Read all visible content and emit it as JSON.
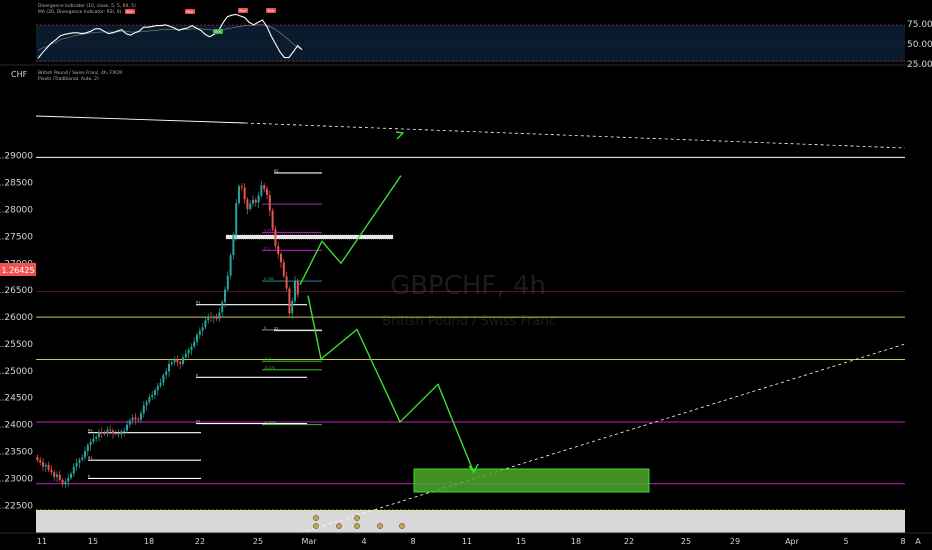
{
  "symbol": "GBPCHF",
  "timeframe": "4h",
  "watermark_title": "GBPCHF, 4h",
  "watermark_subtitle": "British Pound / Swiss Franc",
  "currency_button": "CHF",
  "legend_main": "British Pound / Swiss Franc, 4h, FXCM",
  "legend_pivots": "Pivots (Traditional, Auto, 2)",
  "osc_legend_1": "Divergence Indicator (10, close, 5, 5, 60, 5)",
  "osc_legend_2": "MA (20, Divergence Indicator: RSI, 0)",
  "current_price_label": "1.26425",
  "axis_corner_label": "A",
  "colors": {
    "up": "#26a69a",
    "down": "#ef5350",
    "projection": "#39e02f",
    "target_zone": "#4ea82a",
    "pivot_yellow": "#d4c64a",
    "pivot_magenta": "#c21fc2",
    "trend_white": "#ffffff"
  },
  "chart_data": [
    {
      "type": "line",
      "title": "GBPCHF, 4h",
      "subtitle": "British Pound / Swiss Franc",
      "ylim": [
        1.2232,
        1.2985
      ],
      "y_ticks": [
        "1.29000",
        "1.28500",
        "1.28000",
        "1.27500",
        "1.27000",
        "1.26500",
        "1.26000",
        "1.25500",
        "1.25000",
        "1.24500",
        "1.24000",
        "1.23500",
        "1.23000",
        "1.22500"
      ],
      "x_ticks": [
        "11",
        "15",
        "18",
        "22",
        "25",
        "Mar",
        "4",
        "8",
        "11",
        "15",
        "18",
        "22",
        "25",
        "29",
        "Apr",
        "5",
        "8"
      ],
      "current_price": 1.26425,
      "candle_closes": [
        1.2334,
        1.233,
        1.2322,
        1.2325,
        1.2316,
        1.2312,
        1.2303,
        1.2307,
        1.2297,
        1.229,
        1.2294,
        1.2301,
        1.2309,
        1.2322,
        1.2329,
        1.2335,
        1.2339,
        1.2351,
        1.2362,
        1.2368,
        1.2374,
        1.2377,
        1.2386,
        1.2385,
        1.2383,
        1.2391,
        1.2389,
        1.2384,
        1.2384,
        1.2382,
        1.2388,
        1.2389,
        1.24,
        1.2408,
        1.2413,
        1.241,
        1.2409,
        1.2421,
        1.2436,
        1.2442,
        1.2451,
        1.2455,
        1.2464,
        1.2472,
        1.2478,
        1.2492,
        1.2499,
        1.2513,
        1.2516,
        1.2521,
        1.2516,
        1.2513,
        1.2525,
        1.2532,
        1.2539,
        1.2545,
        1.2554,
        1.2567,
        1.2575,
        1.2581,
        1.2594,
        1.2601,
        1.2599,
        1.26,
        1.2597,
        1.2609,
        1.2628,
        1.2651,
        1.2677,
        1.2715,
        1.2752,
        1.2812,
        1.2843,
        1.2841,
        1.2819,
        1.2801,
        1.2811,
        1.2818,
        1.2813,
        1.2826,
        1.2845,
        1.2838,
        1.2827,
        1.2798,
        1.2764,
        1.2732,
        1.2717,
        1.2702,
        1.2676,
        1.2653,
        1.2607,
        1.263,
        1.2668,
        1.2642
      ],
      "pivot_lines": [
        {
          "price": 1.2897,
          "color": "#ffffff",
          "style": "solid"
        },
        {
          "price": 1.2647,
          "color": "#ef5350",
          "style": "solid"
        },
        {
          "price": 1.26,
          "color": "#d4c64a",
          "style": "solid"
        },
        {
          "price": 1.2521,
          "color": "#d4c64a",
          "style": "solid"
        },
        {
          "price": 1.2405,
          "color": "#c21fc2",
          "style": "solid"
        },
        {
          "price": 1.229,
          "color": "#c21fc2",
          "style": "solid"
        }
      ],
      "resistance_band": {
        "from": 1.2694,
        "to": 1.2698
      },
      "target_zone": {
        "from": 1.2289,
        "to": 1.2318
      },
      "pivot_labels": [
        "R2",
        "R1",
        "P",
        "S1",
        "S2"
      ],
      "fib_labels": [
        "0.618",
        "0.5",
        "0.382",
        "0",
        "-0.2",
        "-0.272",
        "-0.618"
      ],
      "projection_path": [
        1.266,
        1.2741,
        1.27,
        1.2863
      ],
      "bearish_path": [
        1.264,
        1.2522,
        1.2577,
        1.2405,
        1.2475,
        1.231
      ]
    },
    {
      "type": "line",
      "title": "Divergence Indicator",
      "ylim": [
        20,
        100
      ],
      "y_ticks": [
        "75.00",
        "50.00",
        "25.00"
      ],
      "bands": [
        70,
        30
      ],
      "rsi_values": [
        32,
        39,
        45,
        51,
        55,
        60,
        62,
        63,
        64,
        64,
        63,
        64,
        66,
        69,
        69,
        66,
        63,
        64,
        66,
        68,
        63,
        61,
        64,
        66,
        71,
        71,
        72,
        73,
        73,
        74,
        72,
        70,
        67,
        69,
        70,
        73,
        70,
        67,
        62,
        59,
        62,
        66,
        76,
        84,
        86,
        87,
        85,
        83,
        77,
        74,
        77,
        80,
        72,
        60,
        50,
        40,
        33,
        33,
        40,
        48,
        43
      ],
      "ma_values": [
        42,
        45,
        47,
        50,
        52,
        55,
        57,
        58,
        60,
        61,
        62,
        63,
        64,
        64,
        65,
        65,
        65,
        65,
        65,
        66,
        66,
        65,
        65,
        65,
        66,
        66,
        67,
        67,
        68,
        68,
        68,
        68,
        68,
        68,
        68,
        69,
        69,
        69,
        68,
        68,
        67,
        67,
        68,
        69,
        70,
        71,
        72,
        73,
        73,
        73,
        74,
        74,
        73,
        71,
        68,
        64,
        60,
        55,
        50,
        46,
        43
      ],
      "markers": [
        "Bear",
        "Bear",
        "Bull",
        "Bear",
        "Bear"
      ]
    }
  ]
}
